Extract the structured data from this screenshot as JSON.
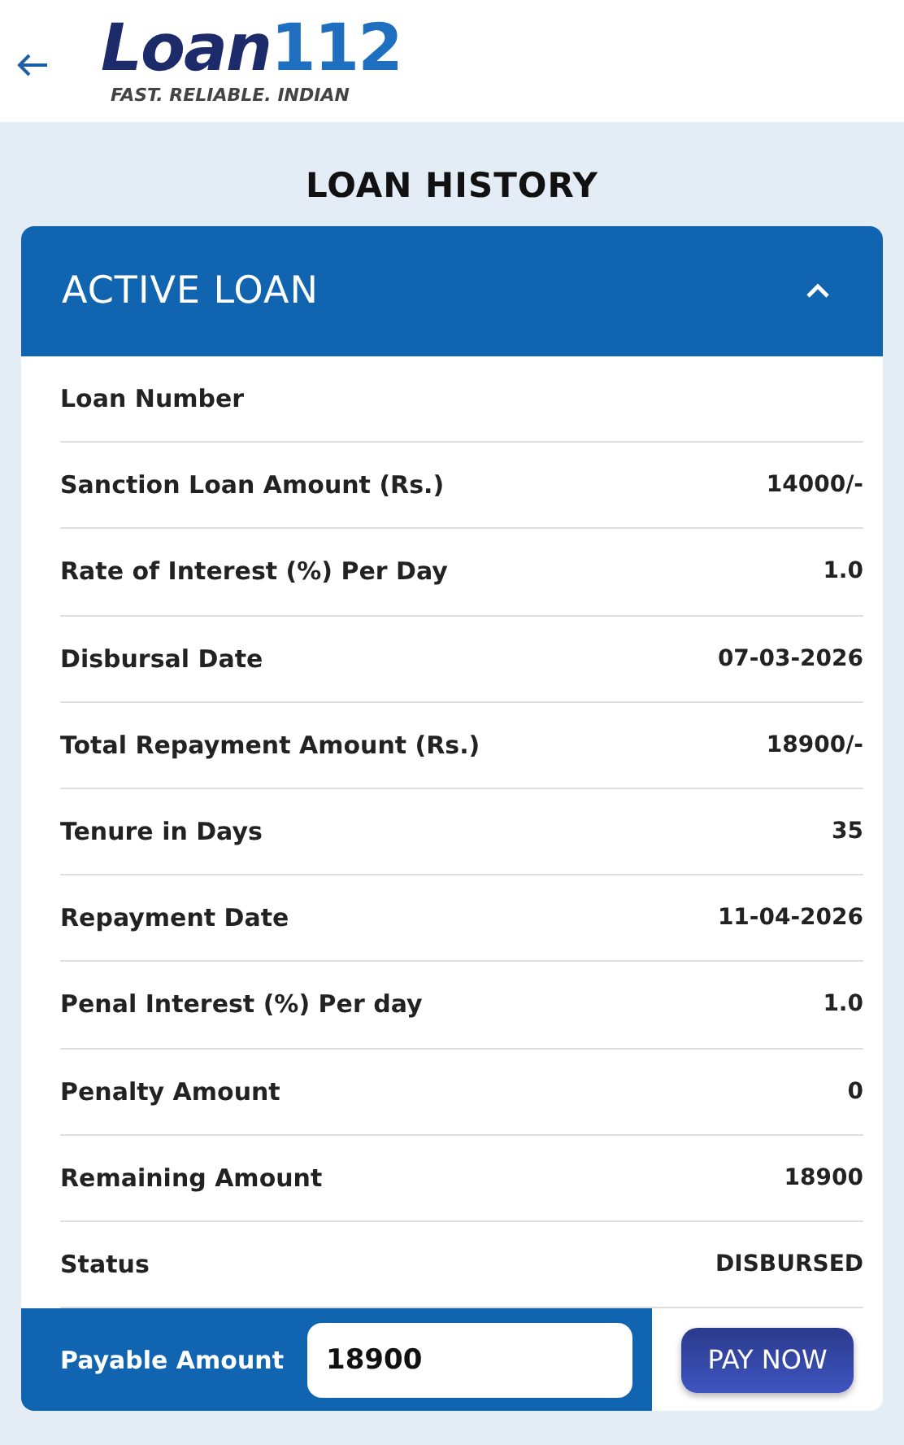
{
  "logo": {
    "name": "Loan",
    "number": "112",
    "tagline": "FAST. RELIABLE. INDIAN"
  },
  "page_title": "LOAN HISTORY",
  "card": {
    "title": "ACTIVE LOAN",
    "expanded": true,
    "rows": [
      {
        "label": "Loan Number"
      },
      {
        "label": "Sanction Loan Amount (Rs.)",
        "value": "14000/-"
      },
      {
        "label": "Rate of Interest (%) Per Day",
        "value": "1.0"
      },
      {
        "label": "Disbursal Date",
        "value": "07-03-2026"
      },
      {
        "label": "Total Repayment Amount (Rs.)",
        "value": "18900/-"
      },
      {
        "label": "Tenure in Days",
        "value": "35"
      },
      {
        "label": "Repayment Date",
        "value": "11-04-2026"
      },
      {
        "label": "Penal Interest (%) Per day",
        "value": "1.0"
      },
      {
        "label": "Penalty Amount",
        "value": "0"
      },
      {
        "label": "Remaining Amount",
        "value": "18900"
      },
      {
        "label": "Status",
        "value": "DISBURSED"
      }
    ],
    "payable_label": "Payable Amount",
    "payable_value": "18900",
    "pay_button": "PAY NOW"
  }
}
